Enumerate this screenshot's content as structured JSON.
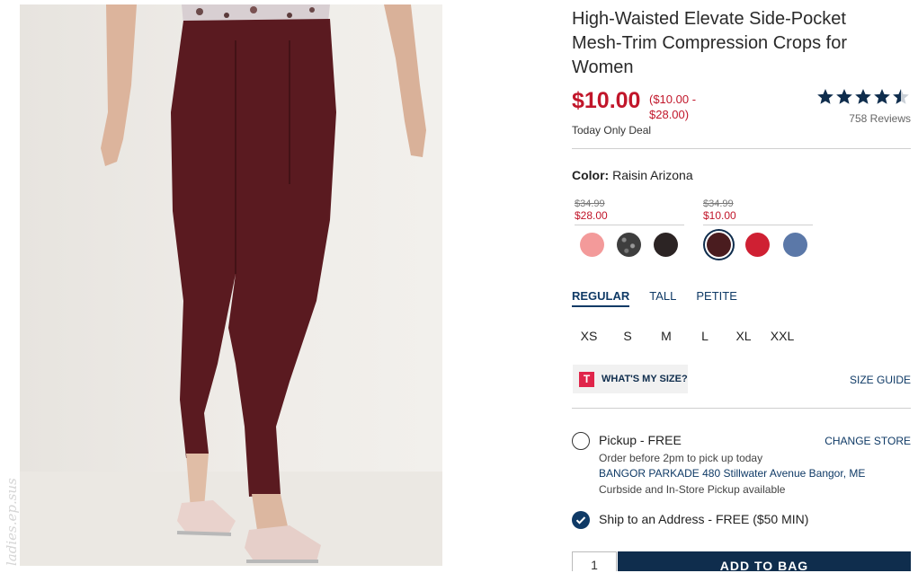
{
  "product": {
    "title": "High-Waisted Elevate Side-Pocket Mesh-Trim Compression Crops for Women",
    "price": "$10.00",
    "price_range": "($10.00 - $28.00)",
    "deal": "Today Only Deal",
    "rating": 4.5,
    "reviews": "758 Reviews"
  },
  "color": {
    "label": "Color:",
    "value": "Raisin Arizona",
    "groups": [
      {
        "original": "$34.99",
        "sale": "$28.00"
      },
      {
        "original": "$34.99",
        "sale": "$10.00"
      }
    ],
    "swatches": [
      {
        "name": "swatch-coral",
        "color": "#f39a9a"
      },
      {
        "name": "swatch-space-dye",
        "color": "#4a4a4a"
      },
      {
        "name": "swatch-black",
        "color": "#2c2424"
      },
      {
        "name": "swatch-raisin-arizona",
        "color": "#4a1c1f",
        "selected": true
      },
      {
        "name": "swatch-red",
        "color": "#cf2033"
      },
      {
        "name": "swatch-blue",
        "color": "#5b78a8"
      }
    ]
  },
  "fit": {
    "tabs": [
      "REGULAR",
      "TALL",
      "PETITE"
    ],
    "active": "REGULAR"
  },
  "sizes": [
    "XS",
    "S",
    "M",
    "L",
    "XL",
    "XXL"
  ],
  "size_help": {
    "whats_my_size": "WHAT'S MY SIZE?",
    "badge": "T",
    "size_guide": "SIZE GUIDE"
  },
  "fulfillment": {
    "pickup_label": "Pickup - FREE",
    "change_store": "CHANGE STORE",
    "pickup_note": "Order before 2pm to pick up today",
    "store": "BANGOR PARKADE 480 Stillwater Avenue  Bangor, ME",
    "curbside": "Curbside and In-Store Pickup available",
    "ship_label": "Ship to an Address - FREE ($50 MIN)"
  },
  "cart": {
    "qty": "1",
    "add_label": "ADD TO BAG"
  },
  "watermark": "ladies.ep.sus",
  "colors": {
    "sale_red": "#c1162a",
    "navy": "#0f2d4d"
  }
}
